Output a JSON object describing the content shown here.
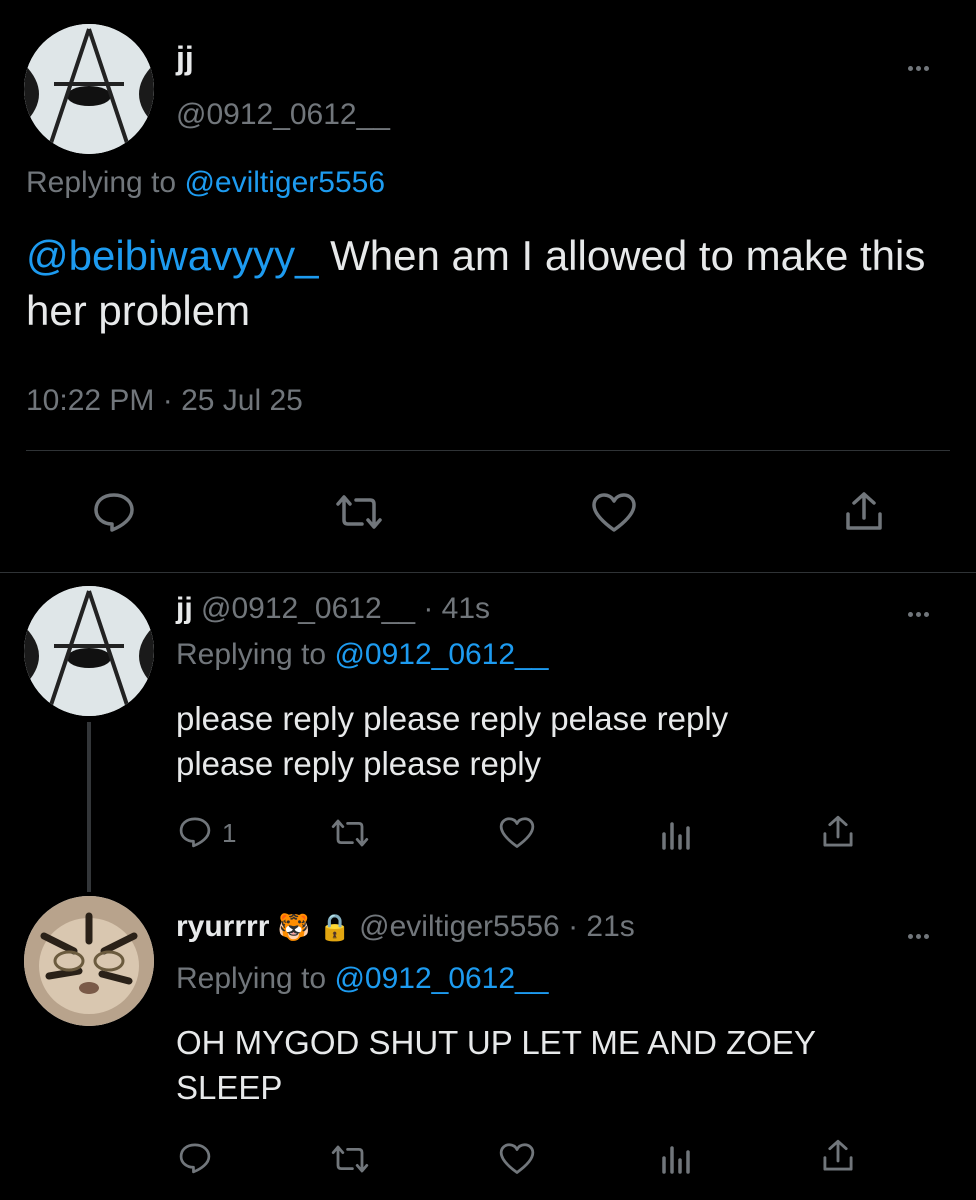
{
  "main_tweet": {
    "display_name": "jj",
    "handle": "@0912_0612__",
    "replying_prefix": "Replying to",
    "replying_to": "@eviltiger5556",
    "mention": "@beibiwavyyy_",
    "text": " When am I allowed to make this her problem",
    "timestamp": "10:22 PM · 25 Jul 25"
  },
  "reply_1": {
    "display_name": "jj",
    "handle": "@0912_0612__",
    "time": "· 41s",
    "replying_prefix": "Replying to",
    "replying_to": "@0912_0612__",
    "text_line1": "please reply please reply pelase reply",
    "text_line2": "please reply please reply",
    "reply_count": "1"
  },
  "reply_2": {
    "display_name": "ryurrrr",
    "emoji": "🐯",
    "lock": "🔒",
    "handle": "@eviltiger5556",
    "time": "· 21s",
    "replying_prefix": "Replying to",
    "replying_to": "@0912_0612__",
    "text_line1": "OH MYGOD SHUT UP LET ME AND ZOEY",
    "text_line2": "SLEEP"
  },
  "colors": {
    "background": "#000000",
    "accent": "#1d9bf0",
    "muted": "#71767b",
    "text": "#e7e9ea"
  }
}
